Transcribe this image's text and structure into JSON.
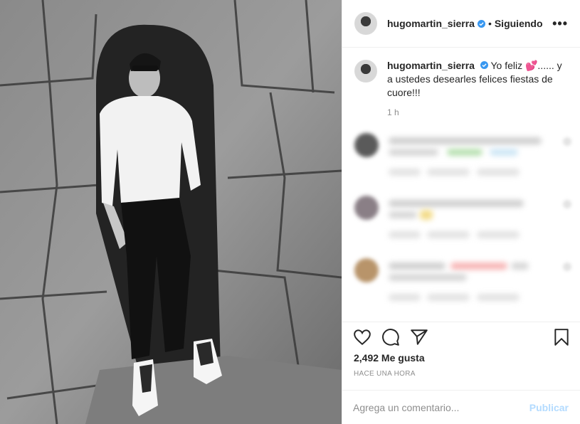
{
  "post": {
    "username": "hugomartin_sierra",
    "separator": "•",
    "follow_label": "Siguiendo",
    "more_label": "•••",
    "caption_text": " Yo feliz 💕...... y a ustedes desearles felices fiestas de cuore!!!",
    "caption_time": "1 h",
    "likes": "2,492 Me gusta",
    "time_ago": "HACE UNA HORA",
    "comment_placeholder": "Agrega un comentario...",
    "post_label": "Publicar"
  },
  "icons": {
    "verified": "verified-badge-icon",
    "like": "heart-icon",
    "comment": "comment-icon",
    "share": "paper-plane-icon",
    "save": "bookmark-icon"
  },
  "colors": {
    "verified_blue": "#3897f0",
    "publish_disabled": "#b3dbff",
    "muted_text": "#8e8e8e"
  }
}
